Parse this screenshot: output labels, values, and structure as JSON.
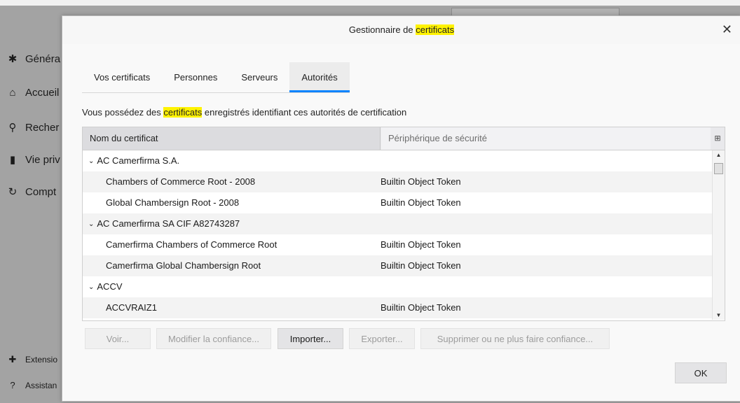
{
  "background": {
    "nav": [
      {
        "label": "Généra",
        "icon": "gear-icon",
        "glyph": "✱"
      },
      {
        "label": "Accueil",
        "icon": "home-icon",
        "glyph": "⌂"
      },
      {
        "label": "Recher",
        "icon": "search-icon",
        "glyph": "⚲"
      },
      {
        "label": "Vie priv",
        "icon": "lock-icon",
        "glyph": "▮"
      },
      {
        "label": "Compt",
        "icon": "sync-icon",
        "glyph": "↻"
      }
    ],
    "footer": [
      {
        "label": "Extensio",
        "icon": "puzzle-icon",
        "glyph": "✚"
      },
      {
        "label": "Assistan",
        "icon": "help-icon",
        "glyph": "?"
      }
    ]
  },
  "dialog": {
    "title_before": "Gestionnaire de ",
    "title_highlight": "certificats",
    "close_glyph": "✕",
    "tabs": [
      {
        "label": "Vos certificats",
        "active": false
      },
      {
        "label": "Personnes",
        "active": false
      },
      {
        "label": "Serveurs",
        "active": false
      },
      {
        "label": "Autorités",
        "active": true
      }
    ],
    "description_before": "Vous possédez des ",
    "description_highlight": "certificats",
    "description_after": " enregistrés identifiant ces autorités de certification",
    "columns": {
      "name": "Nom du certificat",
      "device": "Périphérique de sécurité",
      "picker_glyph": "⊞"
    },
    "rows": [
      {
        "group": true,
        "name": "AC Camerfirma S.A.",
        "device": ""
      },
      {
        "group": false,
        "name": "Chambers of Commerce Root - 2008",
        "device": "Builtin Object Token"
      },
      {
        "group": false,
        "name": "Global Chambersign Root - 2008",
        "device": "Builtin Object Token"
      },
      {
        "group": true,
        "name": "AC Camerfirma SA CIF A82743287",
        "device": ""
      },
      {
        "group": false,
        "name": "Camerfirma Chambers of Commerce Root",
        "device": "Builtin Object Token"
      },
      {
        "group": false,
        "name": "Camerfirma Global Chambersign Root",
        "device": "Builtin Object Token"
      },
      {
        "group": true,
        "name": "ACCV",
        "device": ""
      },
      {
        "group": false,
        "name": "ACCVRAIZ1",
        "device": "Builtin Object Token"
      }
    ],
    "twisty_glyph": "⌄",
    "buttons": {
      "view": "Voir...",
      "edit_trust": "Modifier la confiance...",
      "import": "Importer...",
      "export": "Exporter...",
      "delete": "Supprimer ou ne plus faire confiance..."
    },
    "ok": "OK"
  },
  "colors": {
    "highlight": "#fff200",
    "tab_accent": "#0a84ff"
  }
}
